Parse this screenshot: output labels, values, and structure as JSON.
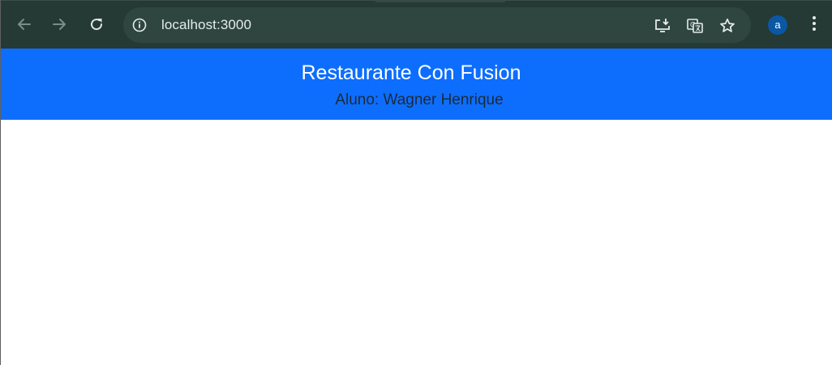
{
  "browser": {
    "url": "localhost:3000",
    "profile_initial": "a",
    "theme_colors": {
      "toolbar": "#253a35",
      "omnibox": "#2f4640",
      "avatar": "#0b57a4"
    },
    "toolbar_icons": [
      "back-arrow-icon",
      "forward-arrow-icon",
      "reload-icon",
      "site-info-icon",
      "install-app-icon",
      "translate-icon",
      "bookmark-star-icon",
      "kebab-menu-icon"
    ]
  },
  "page": {
    "header": {
      "title": "Restaurante Con Fusion",
      "subtitle": "Aluno: Wagner Henrique",
      "background": "#0d6efd"
    }
  }
}
